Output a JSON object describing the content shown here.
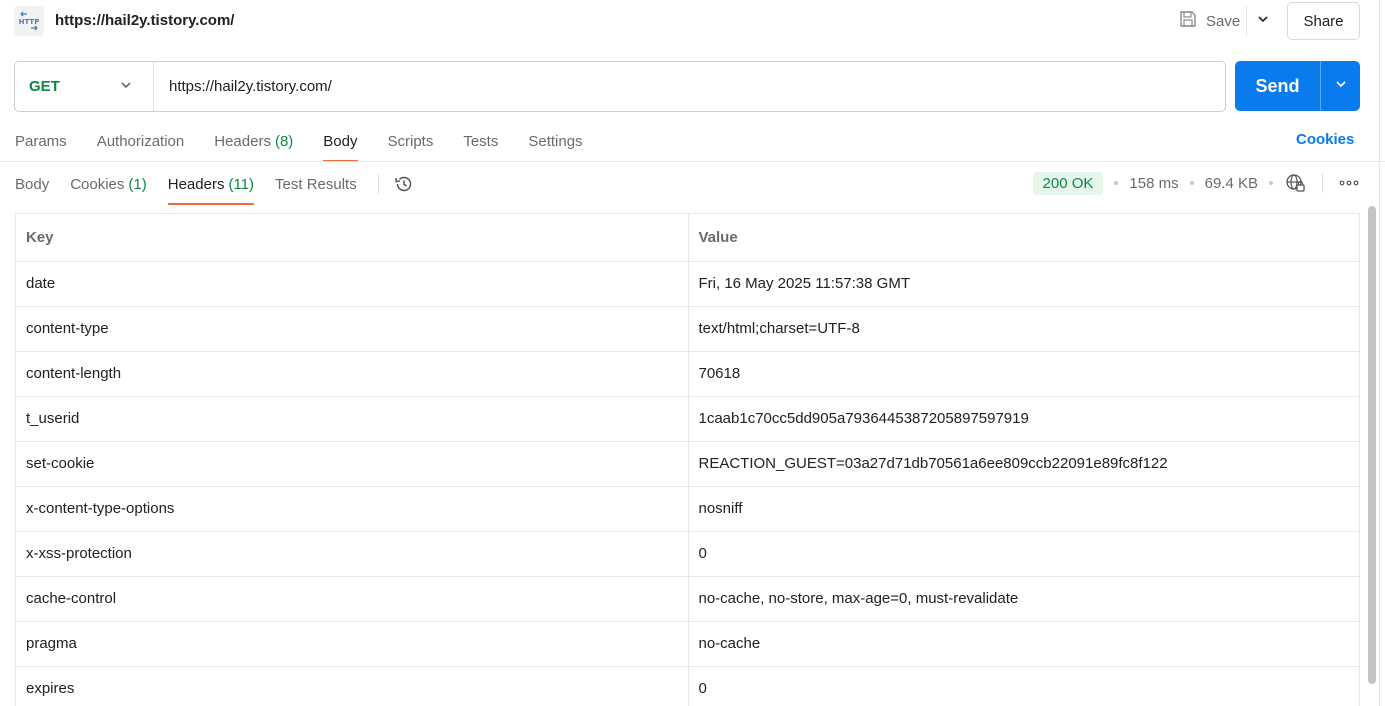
{
  "request": {
    "icon_label": "HTTP",
    "title": "https://hail2y.tistory.com/",
    "save_label": "Save",
    "share_label": "Share",
    "method": "GET",
    "url": "https://hail2y.tistory.com/",
    "send_label": "Send"
  },
  "request_tabs": [
    {
      "label": "Params",
      "count": null,
      "active": false
    },
    {
      "label": "Authorization",
      "count": null,
      "active": false
    },
    {
      "label": "Headers",
      "count": "(8)",
      "active": false
    },
    {
      "label": "Body",
      "count": null,
      "active": true
    },
    {
      "label": "Scripts",
      "count": null,
      "active": false
    },
    {
      "label": "Tests",
      "count": null,
      "active": false
    },
    {
      "label": "Settings",
      "count": null,
      "active": false
    }
  ],
  "cookies_link": "Cookies",
  "response_tabs": [
    {
      "label": "Body",
      "count": null,
      "active": false
    },
    {
      "label": "Cookies",
      "count": "(1)",
      "active": false
    },
    {
      "label": "Headers",
      "count": "(11)",
      "active": true
    },
    {
      "label": "Test Results",
      "count": null,
      "active": false
    }
  ],
  "response_meta": {
    "status": "200 OK",
    "time": "158 ms",
    "size": "69.4 KB"
  },
  "headers_table": {
    "columns": [
      "Key",
      "Value"
    ],
    "rows": [
      [
        "date",
        "Fri, 16 May 2025 11:57:38 GMT"
      ],
      [
        "content-type",
        "text/html;charset=UTF-8"
      ],
      [
        "content-length",
        "70618"
      ],
      [
        "t_userid",
        "1caab1c70cc5dd905a7936445387205897597919"
      ],
      [
        "set-cookie",
        "REACTION_GUEST=03a27d71db70561a6ee809ccb22091e89fc8f122"
      ],
      [
        "x-content-type-options",
        "nosniff"
      ],
      [
        "x-xss-protection",
        "0"
      ],
      [
        "cache-control",
        "no-cache, no-store, max-age=0, must-revalidate"
      ],
      [
        "pragma",
        "no-cache"
      ],
      [
        "expires",
        "0"
      ]
    ]
  },
  "colors": {
    "accent_blue": "#097bed",
    "method_green": "#0b8a3f",
    "active_tab_underline": "#f26b3a",
    "status_badge_bg": "#e6f6ea"
  }
}
